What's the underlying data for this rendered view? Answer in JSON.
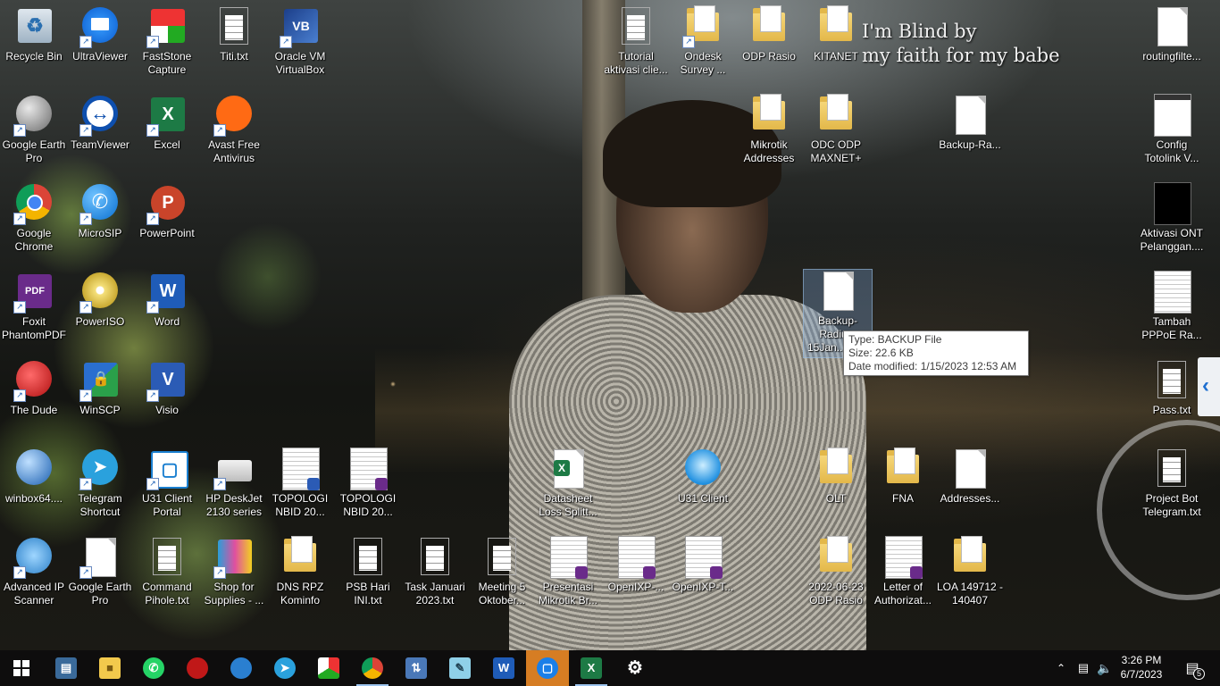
{
  "wallpaper": {
    "text_line1": "I'm Blind by",
    "text_line2": "my faith for my babe"
  },
  "desktop_icons": [
    {
      "label": "Recycle Bin"
    },
    {
      "label": "UltraViewer"
    },
    {
      "label": "FastStone Capture"
    },
    {
      "label": "Titi.txt"
    },
    {
      "label": "Oracle VM VirtualBox"
    },
    {
      "label": "Google Earth Pro"
    },
    {
      "label": "TeamViewer"
    },
    {
      "label": "Excel"
    },
    {
      "label": "Avast Free Antivirus"
    },
    {
      "label": "Google Chrome"
    },
    {
      "label": "MicroSIP"
    },
    {
      "label": "PowerPoint"
    },
    {
      "label": "Foxit PhantomPDF"
    },
    {
      "label": "PowerISO"
    },
    {
      "label": "Word"
    },
    {
      "label": "The Dude"
    },
    {
      "label": "WinSCP"
    },
    {
      "label": "Visio"
    },
    {
      "label": "winbox64...."
    },
    {
      "label": "Telegram Shortcut"
    },
    {
      "label": "U31 Client Portal"
    },
    {
      "label": "HP DeskJet 2130 series"
    },
    {
      "label": "TOPOLOGI NBID 20..."
    },
    {
      "label": "TOPOLOGI NBID 20..."
    },
    {
      "label": "Advanced IP Scanner"
    },
    {
      "label": "Google Earth Pro"
    },
    {
      "label": "Command Pihole.txt"
    },
    {
      "label": "Shop for Supplies - ..."
    },
    {
      "label": "DNS RPZ Kominfo"
    },
    {
      "label": "PSB Hari INI.txt"
    },
    {
      "label": "Task Januari 2023.txt"
    },
    {
      "label": "Meeting 5 Oktober..."
    },
    {
      "label": "Presentasi Mikrotik Br..."
    },
    {
      "label": "OpenIXP-..."
    },
    {
      "label": "OpenIXP-T..."
    },
    {
      "label": "Tutorial aktivasi clie..."
    },
    {
      "label": "Ondesk Survey ..."
    },
    {
      "label": "ODP Rasio"
    },
    {
      "label": "KITANET"
    },
    {
      "label": "Mikrotik Addresses"
    },
    {
      "label": "ODC ODP MAXNET+"
    },
    {
      "label": "Backup-Ra..."
    },
    {
      "label": "Backup-Radius-15Jan...acku"
    },
    {
      "label": "Datasheet Loss Splitt..."
    },
    {
      "label": "U31 Client"
    },
    {
      "label": "OLT"
    },
    {
      "label": "FNA"
    },
    {
      "label": "Addresses..."
    },
    {
      "label": "2022-06-23 ODP Rasio"
    },
    {
      "label": "Letter of Authorizat..."
    },
    {
      "label": "LOA 149712 - 140407"
    },
    {
      "label": "routingfilte..."
    },
    {
      "label": "Config Totolink V..."
    },
    {
      "label": "Aktivasi ONT Pelanggan...."
    },
    {
      "label": "Tambah PPPoE Ra..."
    },
    {
      "label": "Pass.txt"
    },
    {
      "label": "Project Bot Telegram.txt"
    }
  ],
  "tooltip": {
    "type": "Type: BACKUP File",
    "size": "Size: 22.6 KB",
    "modified": "Date modified: 1/15/2023 12:53 AM"
  },
  "taskbar": {
    "apps": [
      "start",
      "network-tool",
      "file-explorer",
      "whatsapp",
      "the-dude",
      "winbox",
      "telegram",
      "faststone",
      "chrome",
      "network-share",
      "notepad",
      "word",
      "ultraviewer",
      "excel",
      "settings"
    ],
    "clock_time": "3:26 PM",
    "clock_date": "6/7/2023",
    "notification_count": "5"
  },
  "colors": {
    "taskbar": "#0e0d0d",
    "active_app": "#d67d23",
    "selection": "#78a0d2"
  }
}
